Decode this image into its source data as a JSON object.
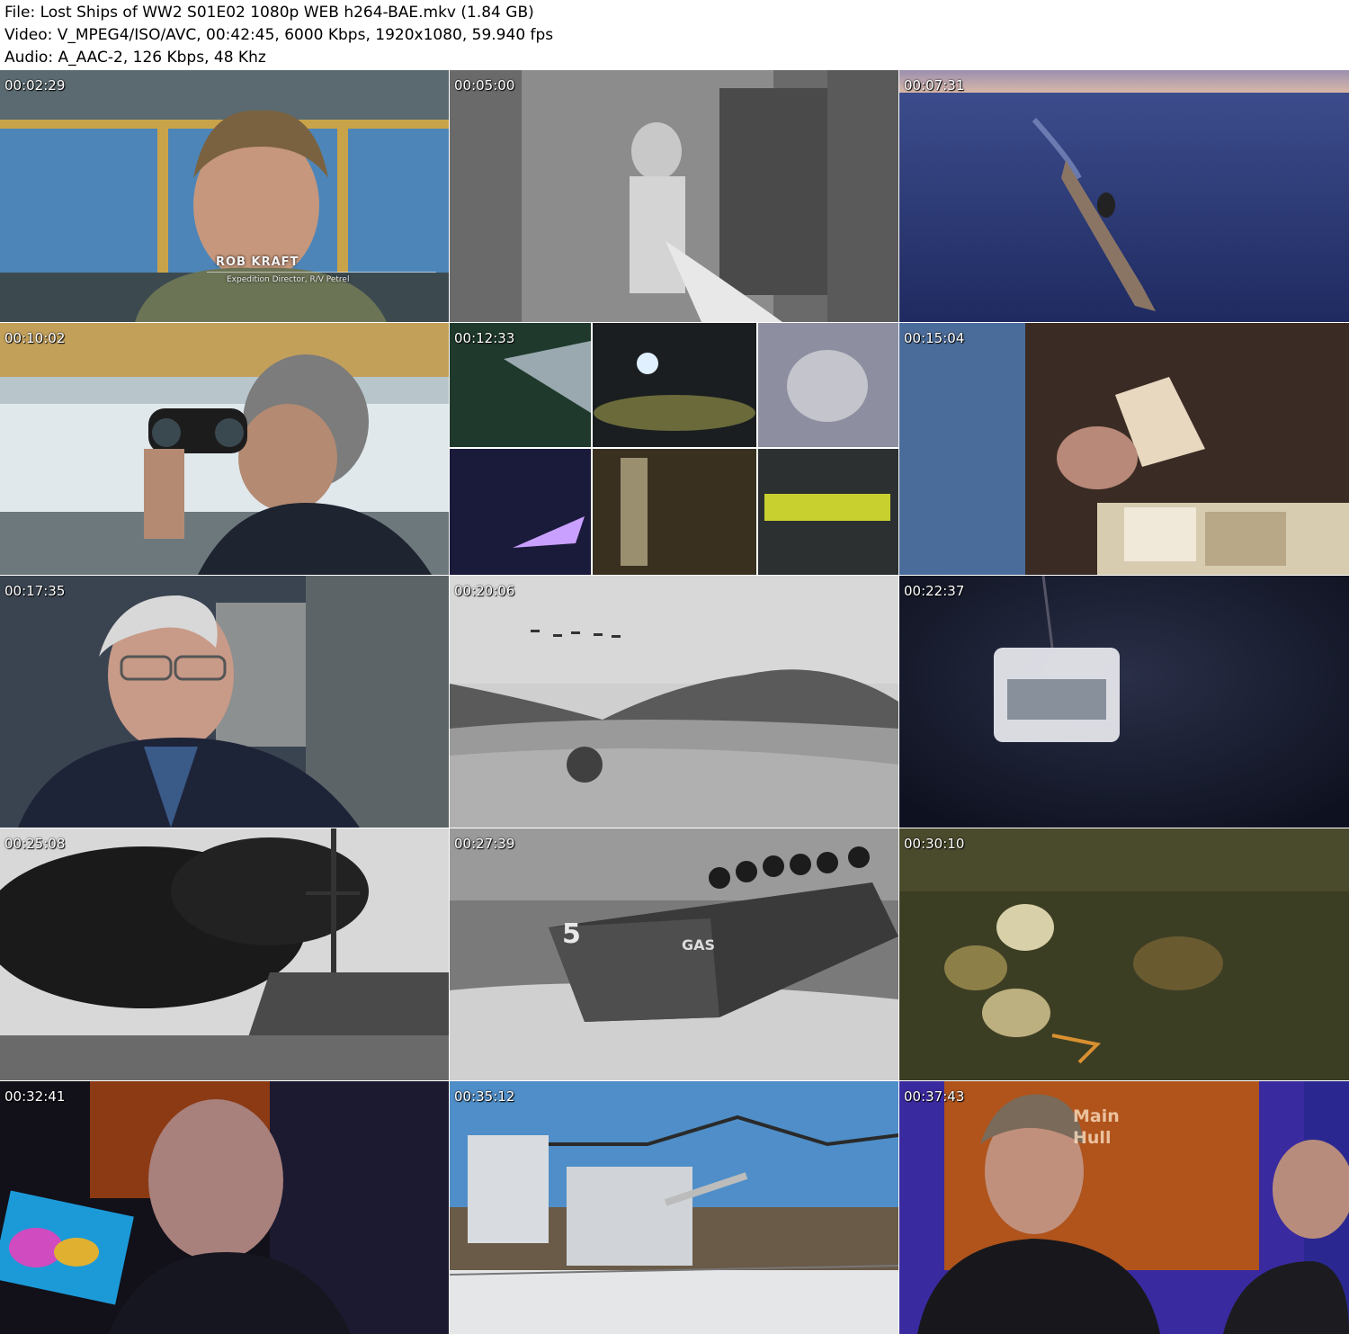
{
  "header": {
    "file_line": "File: Lost Ships of WW2 S01E02 1080p WEB h264-BAE.mkv (1.84 GB)",
    "video_line": "Video: V_MPEG4/ISO/AVC, 00:42:45, 6000 Kbps, 1920x1080, 59.940 fps",
    "audio_line": "Audio: A_AAC-2, 126 Kbps, 48 Khz"
  },
  "thumbnails": [
    {
      "timestamp": "00:02:29",
      "scene": "interview-bridge"
    },
    {
      "timestamp": "00:05:00",
      "scene": "archival-officer"
    },
    {
      "timestamp": "00:07:31",
      "scene": "ship-at-sea"
    },
    {
      "timestamp": "00:10:02",
      "scene": "binoculars"
    },
    {
      "timestamp": "00:12:33",
      "scene": "rov-camera-grid"
    },
    {
      "timestamp": "00:15:04",
      "scene": "scrapbook"
    },
    {
      "timestamp": "00:17:35",
      "scene": "veteran-interview"
    },
    {
      "timestamp": "00:20:06",
      "scene": "archival-valley-planes"
    },
    {
      "timestamp": "00:22:37",
      "scene": "rov-descending"
    },
    {
      "timestamp": "00:25:08",
      "scene": "archival-ship-smoke"
    },
    {
      "timestamp": "00:27:39",
      "scene": "archival-landing-craft"
    },
    {
      "timestamp": "00:30:10",
      "scene": "wreck-debris-seafloor"
    },
    {
      "timestamp": "00:32:41",
      "scene": "sonar-screen-man"
    },
    {
      "timestamp": "00:35:12",
      "scene": "museum-ship-bridge"
    },
    {
      "timestamp": "00:37:43",
      "scene": "two-men-display"
    }
  ],
  "overlays": {
    "lower_third_name": "ROB KRAFT",
    "lower_third_role": "Expedition Director, R/V Petrel",
    "boat_number": "5",
    "boat_text": "GAS",
    "display_text_1": "Main",
    "display_text_2": "Hull"
  }
}
